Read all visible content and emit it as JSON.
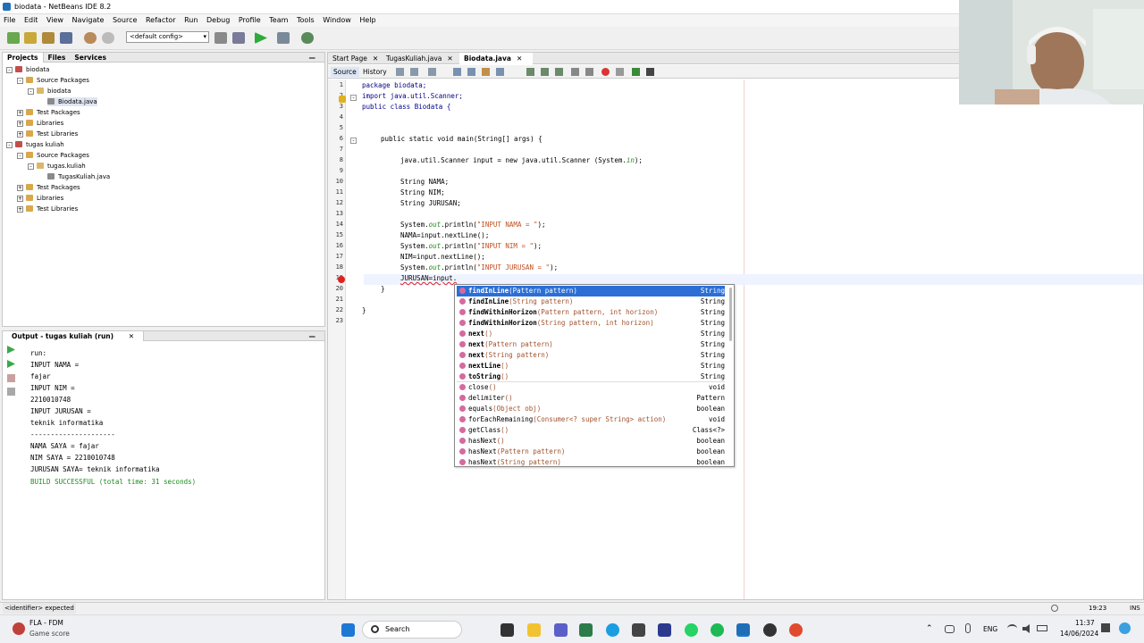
{
  "window": {
    "title": "biodata - NetBeans IDE 8.2"
  },
  "menu": [
    "File",
    "Edit",
    "View",
    "Navigate",
    "Source",
    "Refactor",
    "Run",
    "Debug",
    "Profile",
    "Team",
    "Tools",
    "Window",
    "Help"
  ],
  "toolbar": {
    "config": "<default config>"
  },
  "projects": {
    "tabs": [
      "Projects",
      "Files",
      "Services"
    ],
    "minimize": "—",
    "tree": [
      {
        "label": "biodata",
        "level": 0,
        "type": "project"
      },
      {
        "label": "Source Packages",
        "level": 1,
        "type": "folder"
      },
      {
        "label": "biodata",
        "level": 2,
        "type": "package"
      },
      {
        "label": "Biodata.java",
        "level": 3,
        "type": "java"
      },
      {
        "label": "Test Packages",
        "level": 1,
        "type": "folder"
      },
      {
        "label": "Libraries",
        "level": 1,
        "type": "folder"
      },
      {
        "label": "Test Libraries",
        "level": 1,
        "type": "folder"
      },
      {
        "label": "tugas kuliah",
        "level": 0,
        "type": "project"
      },
      {
        "label": "Source Packages",
        "level": 1,
        "type": "folder"
      },
      {
        "label": "tugas.kuliah",
        "level": 2,
        "type": "package"
      },
      {
        "label": "TugasKuliah.java",
        "level": 3,
        "type": "java"
      },
      {
        "label": "Test Packages",
        "level": 1,
        "type": "folder"
      },
      {
        "label": "Libraries",
        "level": 1,
        "type": "folder"
      },
      {
        "label": "Test Libraries",
        "level": 1,
        "type": "folder"
      }
    ]
  },
  "output": {
    "title": "Output - tugas kuliah (run)",
    "close": "✕",
    "minimize": "—",
    "lines": [
      "run:",
      "INPUT NAMA = ",
      "fajar",
      "INPUT NIM = ",
      "2210010748",
      "INPUT JURUSAN = ",
      "teknik informatika",
      "---------------------",
      "NAMA SAYA = fajar",
      "NIM SAYA = 2210010748",
      "JURUSAN SAYA= teknik informatika",
      "BUILD SUCCESSFUL (total time: 31 seconds)"
    ]
  },
  "editor": {
    "tabs": [
      "Start Page",
      "TugasKuliah.java",
      "Biodata.java"
    ],
    "tab_close": "✕",
    "views": [
      "Source",
      "History"
    ],
    "line_numbers": [
      "1",
      "2",
      "3",
      "4",
      "5",
      "6",
      "7",
      "8",
      "9",
      "10",
      "11",
      "12",
      "13",
      "14",
      "15",
      "16",
      "17",
      "18",
      "19",
      "20",
      "21",
      "22",
      "23"
    ],
    "code": {
      "l1": [
        "package biodata;"
      ],
      "l2": [
        "import java.util.Scanner;"
      ],
      "l3": [
        "public class Biodata {"
      ],
      "l6": [
        "public static void main(String[] args) {"
      ],
      "l8": [
        "java.util.Scanner input = new java.util.Scanner (System.",
        "in",
        ");"
      ],
      "l10": [
        "String NAMA;"
      ],
      "l11": [
        "String NIM;"
      ],
      "l12": [
        "String JURUSAN;"
      ],
      "l14": [
        "System.",
        "out",
        ".println(",
        "\"INPUT NAMA = \"",
        ");"
      ],
      "l15": [
        "NAMA=input.nextLine();"
      ],
      "l16": [
        "System.",
        "out",
        ".println(",
        "\"INPUT NIM = \"",
        ");"
      ],
      "l17": [
        "NIM=input.nextLine();"
      ],
      "l18": [
        "System.",
        "out",
        ".println(",
        "\"INPUT JURUSAN = \"",
        ");"
      ],
      "l19": [
        "JURUSAN=input."
      ],
      "l20": [
        "}"
      ],
      "l22": [
        "}"
      ]
    }
  },
  "completion": [
    {
      "name": "findInLine",
      "params": "(Pattern pattern)",
      "type": "String",
      "selected": true
    },
    {
      "name": "findInLine",
      "params": "(String pattern)",
      "type": "String"
    },
    {
      "name": "findWithinHorizon",
      "params": "(Pattern pattern, int horizon)",
      "type": "String"
    },
    {
      "name": "findWithinHorizon",
      "params": "(String pattern, int horizon)",
      "type": "String"
    },
    {
      "name": "next",
      "params": "()",
      "type": "String"
    },
    {
      "name": "next",
      "params": "(Pattern pattern)",
      "type": "String"
    },
    {
      "name": "next",
      "params": "(String pattern)",
      "type": "String"
    },
    {
      "name": "nextLine",
      "params": "()",
      "type": "String"
    },
    {
      "name": "toString",
      "params": "()",
      "type": "String"
    },
    {
      "name": "close",
      "params": "()",
      "type": "void"
    },
    {
      "name": "delimiter",
      "params": "()",
      "type": "Pattern"
    },
    {
      "name": "equals",
      "params": "(Object obj)",
      "type": "boolean"
    },
    {
      "name": "forEachRemaining",
      "params": "(Consumer<? super String> action)",
      "type": "void"
    },
    {
      "name": "getClass",
      "params": "()",
      "type": "Class<?>"
    },
    {
      "name": "hasNext",
      "params": "()",
      "type": "boolean"
    },
    {
      "name": "hasNext",
      "params": "(Pattern pattern)",
      "type": "boolean"
    },
    {
      "name": "hasNext",
      "params": "(String pattern)",
      "type": "boolean"
    }
  ],
  "status": {
    "message": "<identifier> expected",
    "position": "19:23",
    "mode": "INS"
  },
  "taskbar": {
    "weather_title": "FLA - FDM",
    "weather_sub": "Game score",
    "search": "Search",
    "lang": "ENG",
    "time": "11:37",
    "date": "14/06/2024"
  },
  "colors": {
    "selection": "#2b6fd6",
    "keyword": "#00008b",
    "string": "#c05020"
  }
}
